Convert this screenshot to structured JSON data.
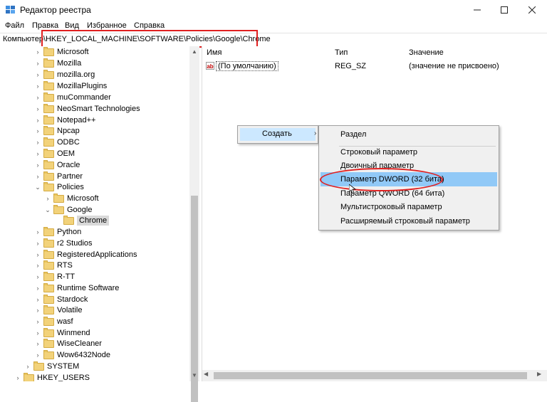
{
  "window": {
    "title": "Редактор реестра"
  },
  "menu": [
    "Файл",
    "Правка",
    "Вид",
    "Избранное",
    "Справка"
  ],
  "address": {
    "value": "Компьютер\\HKEY_LOCAL_MACHINE\\SOFTWARE\\Policies\\Google\\Chrome"
  },
  "tree": {
    "items": [
      {
        "label": "Microsoft",
        "expanded": false
      },
      {
        "label": "Mozilla",
        "expanded": false
      },
      {
        "label": "mozilla.org",
        "expanded": false
      },
      {
        "label": "MozillaPlugins",
        "expanded": false
      },
      {
        "label": "muCommander",
        "expanded": false
      },
      {
        "label": "NeoSmart Technologies",
        "expanded": false
      },
      {
        "label": "Notepad++",
        "expanded": false
      },
      {
        "label": "Npcap",
        "expanded": false
      },
      {
        "label": "ODBC",
        "expanded": false
      },
      {
        "label": "OEM",
        "expanded": false
      },
      {
        "label": "Oracle",
        "expanded": false
      },
      {
        "label": "Partner",
        "expanded": false
      },
      {
        "label": "Policies",
        "expanded": true
      },
      {
        "label": "Microsoft",
        "expanded": false
      },
      {
        "label": "Google",
        "expanded": true
      },
      {
        "label": "Chrome",
        "selected": true
      },
      {
        "label": "Python",
        "expanded": false
      },
      {
        "label": "r2 Studios",
        "expanded": false
      },
      {
        "label": "RegisteredApplications",
        "expanded": false
      },
      {
        "label": "RTS",
        "expanded": false
      },
      {
        "label": "R-TT",
        "expanded": false
      },
      {
        "label": "Runtime Software",
        "expanded": false
      },
      {
        "label": "Stardock",
        "expanded": false
      },
      {
        "label": "Volatile",
        "expanded": false
      },
      {
        "label": "wasf",
        "expanded": false
      },
      {
        "label": "Winmend",
        "expanded": false
      },
      {
        "label": "WiseCleaner",
        "expanded": false
      },
      {
        "label": "Wow6432Node",
        "expanded": false
      },
      {
        "label": "SYSTEM",
        "expanded": false
      },
      {
        "label": "HKEY_USERS",
        "expanded": false
      }
    ]
  },
  "list": {
    "columns": [
      "Имя",
      "Тип",
      "Значение"
    ],
    "rows": [
      {
        "name": "(По умолчанию)",
        "type": "REG_SZ",
        "value": "(значение не присвоено)",
        "icon": "ab"
      }
    ]
  },
  "context_menu": {
    "create_label": "Создать",
    "arrow": "›",
    "submenu": [
      "Раздел",
      "Строковый параметр",
      "Двоичный параметр",
      "Параметр DWORD (32 бита)",
      "Параметр QWORD (64 бита)",
      "Мультистроковый параметр",
      "Расширяемый строковый параметр"
    ]
  },
  "colors": {
    "highlight": "#91c9f7",
    "annotation": "#e02020"
  }
}
